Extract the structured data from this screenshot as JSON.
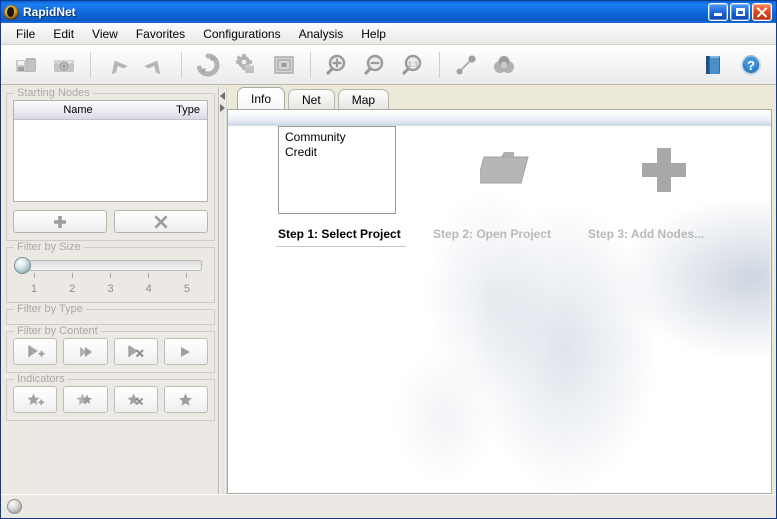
{
  "window": {
    "title": "RapidNet",
    "app_icon": "rapidnet-sphere-icon",
    "minimize_label": "Minimize",
    "maximize_label": "Maximize",
    "close_label": "Close"
  },
  "menubar": {
    "items": [
      {
        "label": "File"
      },
      {
        "label": "Edit"
      },
      {
        "label": "View"
      },
      {
        "label": "Favorites"
      },
      {
        "label": "Configurations"
      },
      {
        "label": "Analysis"
      },
      {
        "label": "Help"
      }
    ]
  },
  "toolbar": {
    "groups": [
      {
        "buttons": [
          {
            "icon": "save-disk-icon",
            "tooltip": "Save"
          },
          {
            "icon": "camera-icon",
            "tooltip": "Snapshot"
          }
        ]
      },
      {
        "buttons": [
          {
            "icon": "undo-arrow-icon",
            "tooltip": "Undo"
          },
          {
            "icon": "redo-arrow-icon",
            "tooltip": "Redo"
          }
        ]
      },
      {
        "buttons": [
          {
            "icon": "refresh-icon",
            "tooltip": "Refresh"
          },
          {
            "icon": "gear-icon",
            "tooltip": "Settings"
          },
          {
            "icon": "grid-layout-icon",
            "tooltip": "Layout"
          }
        ]
      },
      {
        "buttons": [
          {
            "icon": "zoom-in-icon",
            "tooltip": "Zoom In"
          },
          {
            "icon": "zoom-out-icon",
            "tooltip": "Zoom Out"
          },
          {
            "icon": "zoom-actual-icon",
            "tooltip": "Zoom 1:1"
          }
        ]
      },
      {
        "buttons": [
          {
            "icon": "node-link-icon",
            "tooltip": "Link Nodes"
          },
          {
            "icon": "cluster-icon",
            "tooltip": "Cluster"
          }
        ]
      }
    ],
    "right_buttons": [
      {
        "icon": "book-icon",
        "tooltip": "Manual"
      },
      {
        "icon": "help-question-icon",
        "tooltip": "Help"
      }
    ]
  },
  "sidebar": {
    "starting_nodes": {
      "title": "Starting Nodes",
      "columns": [
        "Name",
        "Type"
      ],
      "rows": [],
      "add_button": {
        "icon": "plus-icon",
        "label": "Add"
      },
      "remove_button": {
        "icon": "cross-icon",
        "label": "Remove"
      }
    },
    "filter_by_size": {
      "title": "Filter by Size",
      "ticks": [
        "1",
        "2",
        "3",
        "4",
        "5"
      ],
      "value": 1,
      "min": 1,
      "max": 5
    },
    "filter_by_type": {
      "title": "Filter by Type"
    },
    "filter_by_content": {
      "title": "Filter by Content",
      "buttons": [
        {
          "icon": "flag-add-icon",
          "label": "Add content filter"
        },
        {
          "icon": "flag-double-icon",
          "label": "All content"
        },
        {
          "icon": "flag-remove-icon",
          "label": "Remove content filter"
        },
        {
          "icon": "flag-icon",
          "label": "Content"
        }
      ]
    },
    "indicators": {
      "title": "Indicators",
      "buttons": [
        {
          "icon": "star-add-icon",
          "label": "Add indicator"
        },
        {
          "icon": "star-double-icon",
          "label": "All indicators"
        },
        {
          "icon": "star-remove-icon",
          "label": "Remove indicator"
        },
        {
          "icon": "star-icon",
          "label": "Indicator"
        }
      ]
    }
  },
  "divider": {
    "collapse_left_icon": "triangle-left-icon",
    "collapse_right_icon": "triangle-right-icon"
  },
  "tabs": [
    {
      "label": "Info",
      "active": true
    },
    {
      "label": "Net",
      "active": false
    },
    {
      "label": "Map",
      "active": false
    }
  ],
  "content": {
    "steps": [
      {
        "label": "Step 1: Select Project",
        "visual": "project-list",
        "enabled": true,
        "projects": [
          "Community",
          "Credit"
        ]
      },
      {
        "label": "Step 2: Open Project",
        "visual": "folder-icon",
        "enabled": false
      },
      {
        "label": "Step 3: Add Nodes...",
        "visual": "plus-icon",
        "enabled": false
      }
    ]
  },
  "statusbar": {
    "indicator_icon": "status-led-icon",
    "message": ""
  },
  "colors": {
    "title_bar_blue": "#0f6adc",
    "close_red": "#e24a22",
    "panel_gray": "#ece9e4",
    "group_label_gray": "#a9a9a4",
    "icon_gray": "#8f8f8f",
    "disabled_text": "#b9b9b9",
    "content_white": "#ffffff"
  }
}
